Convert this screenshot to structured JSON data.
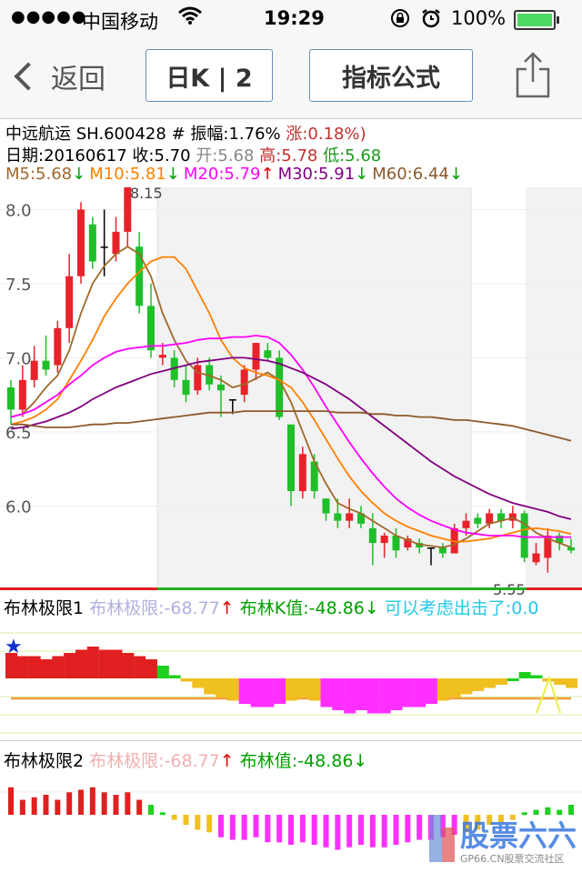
{
  "status_bar": {
    "signal_dots": "●●●●●",
    "carrier": "中国移动",
    "time": "19:29",
    "battery": "100%"
  },
  "nav": {
    "back_label": "返回",
    "period_label": "日K | 2",
    "formula_label": "指标公式"
  },
  "stock": {
    "name": "中远航运",
    "code": "SH.600428",
    "amplitude_label": "# 振幅:",
    "amplitude": "1.76%",
    "change": "涨:0.18%)",
    "date": "日期:20160617",
    "close": "收:5.70",
    "open": "开:5.68",
    "high": "高:5.78",
    "low": "低:5.68"
  },
  "ma_row": [
    {
      "label": "M5:5.68",
      "arrow": "↓",
      "color": "#a0682a",
      "arrow_color": "#00a000"
    },
    {
      "label": "M10:5.81",
      "arrow": "↓",
      "color": "#ff8000",
      "arrow_color": "#00a000"
    },
    {
      "label": "M20:5.79",
      "arrow": "↑",
      "color": "#ff00ff",
      "arrow_color": "#e00000"
    },
    {
      "label": "M30:5.91",
      "arrow": "↓",
      "color": "#800080",
      "arrow_color": "#00a000"
    },
    {
      "label": "M60:6.44",
      "arrow": "↓",
      "color": "#8b5a2b",
      "arrow_color": "#00a000"
    }
  ],
  "panel1": {
    "title": "布林极限1",
    "bl": "布林极限:-68.77",
    "bl_arrow": "↑",
    "k": "布林K值:-48.86",
    "k_arrow": "↓",
    "hint": "可以考虑出击了:0.0"
  },
  "panel2": {
    "title": "布林极限2",
    "bl": "布林极限:-68.77",
    "bl_arrow": "↑",
    "v": "布林值:-48.86",
    "v_arrow": "↓"
  },
  "watermark": {
    "brand": "股票六六",
    "url": "GP66.CN股票交流社区"
  },
  "chart_data": {
    "type": "candlestick",
    "ylim": [
      5.45,
      8.15
    ],
    "yticks": [
      "8.0",
      "7.5",
      "7.0",
      "6.5",
      "6.0"
    ],
    "yticks_values": [
      8.0,
      7.5,
      7.0,
      6.5,
      6.0
    ],
    "max_label": "8.15",
    "min_label": "5.55",
    "colors": {
      "up": "#e8222a",
      "down": "#1fbf2a"
    },
    "candles": [
      [
        6.8,
        6.65,
        6.85,
        6.55
      ],
      [
        6.65,
        6.85,
        6.95,
        6.6
      ],
      [
        6.85,
        6.98,
        7.08,
        6.8
      ],
      [
        6.98,
        6.92,
        7.15,
        6.88
      ],
      [
        6.95,
        7.2,
        7.25,
        6.9
      ],
      [
        7.2,
        7.55,
        7.7,
        7.1
      ],
      [
        7.55,
        8.0,
        8.05,
        7.5
      ],
      [
        7.9,
        7.65,
        7.95,
        7.6
      ],
      [
        7.75,
        7.75,
        8.0,
        7.55
      ],
      [
        7.7,
        7.85,
        7.95,
        7.65
      ],
      [
        7.85,
        8.15,
        8.15,
        7.75
      ],
      [
        7.75,
        7.35,
        7.85,
        7.3
      ],
      [
        7.35,
        7.05,
        7.5,
        7.0
      ],
      [
        7.0,
        7.02,
        7.1,
        6.95
      ],
      [
        7.0,
        6.85,
        7.05,
        6.8
      ],
      [
        6.85,
        6.75,
        6.95,
        6.7
      ],
      [
        6.78,
        6.95,
        7.0,
        6.75
      ],
      [
        6.95,
        6.82,
        7.0,
        6.78
      ],
      [
        6.82,
        6.78,
        6.88,
        6.6
      ],
      [
        6.72,
        6.72,
        6.72,
        6.62
      ],
      [
        6.75,
        6.92,
        6.95,
        6.7
      ],
      [
        6.92,
        7.1,
        7.1,
        6.85
      ],
      [
        7.05,
        7.0,
        7.1,
        6.98
      ],
      [
        7.0,
        6.6,
        7.05,
        6.58
      ],
      [
        6.55,
        6.1,
        6.55,
        6.0
      ],
      [
        6.1,
        6.35,
        6.4,
        6.05
      ],
      [
        6.3,
        6.1,
        6.35,
        6.05
      ],
      [
        6.05,
        5.95,
        6.05,
        5.9
      ],
      [
        5.95,
        5.9,
        6.05,
        5.85
      ],
      [
        5.9,
        5.95,
        6.05,
        5.85
      ],
      [
        5.95,
        5.88,
        6.0,
        5.85
      ],
      [
        5.85,
        5.75,
        5.95,
        5.6
      ],
      [
        5.75,
        5.8,
        5.82,
        5.65
      ],
      [
        5.8,
        5.7,
        5.85,
        5.65
      ],
      [
        5.72,
        5.78,
        5.8,
        5.7
      ],
      [
        5.75,
        5.72,
        5.78,
        5.68
      ],
      [
        5.72,
        5.72,
        5.72,
        5.6
      ],
      [
        5.72,
        5.68,
        5.75,
        5.65
      ],
      [
        5.68,
        5.85,
        5.88,
        5.68
      ],
      [
        5.85,
        5.9,
        5.95,
        5.8
      ],
      [
        5.92,
        5.88,
        5.95,
        5.85
      ],
      [
        5.88,
        5.95,
        5.98,
        5.85
      ],
      [
        5.95,
        5.9,
        5.98,
        5.85
      ],
      [
        5.9,
        5.95,
        6.0,
        5.85
      ],
      [
        5.95,
        5.65,
        5.97,
        5.62
      ],
      [
        5.62,
        5.68,
        5.75,
        5.6
      ],
      [
        5.65,
        5.8,
        5.85,
        5.55
      ],
      [
        5.8,
        5.75,
        5.82,
        5.7
      ],
      [
        5.72,
        5.7,
        5.78,
        5.68
      ]
    ],
    "ma": [
      {
        "name": "M5",
        "color": "#a0682a",
        "values": [
          6.6,
          6.62,
          6.7,
          6.8,
          6.88,
          7.05,
          7.3,
          7.5,
          7.62,
          7.7,
          7.75,
          7.7,
          7.55,
          7.3,
          7.12,
          6.98,
          6.9,
          6.88,
          6.85,
          6.8,
          6.82,
          6.86,
          6.9,
          6.85,
          6.7,
          6.5,
          6.3,
          6.15,
          6.02,
          5.98,
          5.95,
          5.9,
          5.85,
          5.8,
          5.77,
          5.74,
          5.73,
          5.72,
          5.74,
          5.78,
          5.83,
          5.88,
          5.9,
          5.92,
          5.88,
          5.82,
          5.78,
          5.75,
          5.72
        ]
      },
      {
        "name": "M10",
        "color": "#ff8000",
        "values": [
          6.55,
          6.57,
          6.6,
          6.65,
          6.72,
          6.85,
          6.98,
          7.12,
          7.28,
          7.4,
          7.5,
          7.58,
          7.65,
          7.68,
          7.68,
          7.6,
          7.45,
          7.3,
          7.12,
          7.0,
          6.93,
          6.9,
          6.88,
          6.85,
          6.8,
          6.7,
          6.58,
          6.45,
          6.32,
          6.2,
          6.1,
          6.02,
          5.95,
          5.9,
          5.86,
          5.83,
          5.8,
          5.78,
          5.76,
          5.76,
          5.77,
          5.78,
          5.8,
          5.82,
          5.84,
          5.85,
          5.84,
          5.83,
          5.81
        ]
      },
      {
        "name": "M20",
        "color": "#ff00ff",
        "values": [
          6.6,
          6.62,
          6.65,
          6.7,
          6.75,
          6.82,
          6.88,
          6.95,
          7.0,
          7.04,
          7.06,
          7.07,
          7.08,
          7.08,
          7.09,
          7.1,
          7.12,
          7.13,
          7.13,
          7.14,
          7.14,
          7.15,
          7.14,
          7.1,
          7.02,
          6.92,
          6.8,
          6.67,
          6.55,
          6.43,
          6.32,
          6.22,
          6.13,
          6.05,
          5.99,
          5.94,
          5.9,
          5.87,
          5.84,
          5.82,
          5.81,
          5.8,
          5.8,
          5.8,
          5.79,
          5.79,
          5.79,
          5.79,
          5.79
        ]
      },
      {
        "name": "M30",
        "color": "#800080",
        "values": [
          6.52,
          6.53,
          6.55,
          6.57,
          6.6,
          6.63,
          6.67,
          6.72,
          6.76,
          6.8,
          6.83,
          6.86,
          6.89,
          6.91,
          6.93,
          6.95,
          6.97,
          6.98,
          6.99,
          7.0,
          7.0,
          6.99,
          6.98,
          6.96,
          6.93,
          6.9,
          6.86,
          6.82,
          6.77,
          6.72,
          6.66,
          6.6,
          6.54,
          6.48,
          6.42,
          6.36,
          6.3,
          6.25,
          6.2,
          6.16,
          6.12,
          6.08,
          6.05,
          6.02,
          6.0,
          5.98,
          5.96,
          5.93,
          5.91
        ]
      },
      {
        "name": "M60",
        "color": "#8b5a2b",
        "values": [
          6.55,
          6.55,
          6.54,
          6.53,
          6.53,
          6.53,
          6.54,
          6.55,
          6.55,
          6.56,
          6.56,
          6.57,
          6.58,
          6.59,
          6.6,
          6.61,
          6.62,
          6.63,
          6.63,
          6.63,
          6.64,
          6.64,
          6.64,
          6.64,
          6.64,
          6.64,
          6.64,
          6.64,
          6.63,
          6.63,
          6.63,
          6.62,
          6.62,
          6.61,
          6.61,
          6.6,
          6.6,
          6.59,
          6.58,
          6.58,
          6.57,
          6.56,
          6.55,
          6.54,
          6.52,
          6.5,
          6.48,
          6.46,
          6.44
        ]
      }
    ],
    "panel1_values": [
      0.4,
      0.35,
      0.35,
      0.3,
      0.35,
      0.4,
      0.45,
      0.5,
      0.45,
      0.45,
      0.4,
      0.35,
      0.3,
      0.2,
      0.05,
      -0.05,
      -0.15,
      -0.25,
      -0.3,
      -0.35,
      -0.4,
      -0.45,
      -0.45,
      -0.4,
      -0.35,
      -0.3,
      -0.35,
      -0.45,
      -0.5,
      -0.55,
      -0.5,
      -0.55,
      -0.55,
      -0.5,
      -0.45,
      -0.45,
      -0.4,
      -0.35,
      -0.3,
      -0.25,
      -0.2,
      -0.15,
      -0.1,
      0.0,
      0.1,
      0.05,
      -0.05,
      -0.1,
      -0.15
    ],
    "panel2_values": [
      0.55,
      0.3,
      0.35,
      0.4,
      0.3,
      0.45,
      0.5,
      0.55,
      0.45,
      0.4,
      0.45,
      0.3,
      0.2,
      0.05,
      -0.1,
      -0.2,
      -0.3,
      -0.35,
      -0.45,
      -0.5,
      -0.5,
      -0.45,
      -0.55,
      -0.55,
      -0.6,
      -0.55,
      -0.6,
      -0.65,
      -0.7,
      -0.65,
      -0.6,
      -0.65,
      -0.65,
      -0.6,
      -0.55,
      -0.5,
      -0.5,
      -0.45,
      -0.4,
      -0.35,
      -0.3,
      -0.2,
      -0.15,
      -0.1,
      0.05,
      0.1,
      0.15,
      0.1,
      0.2
    ]
  }
}
